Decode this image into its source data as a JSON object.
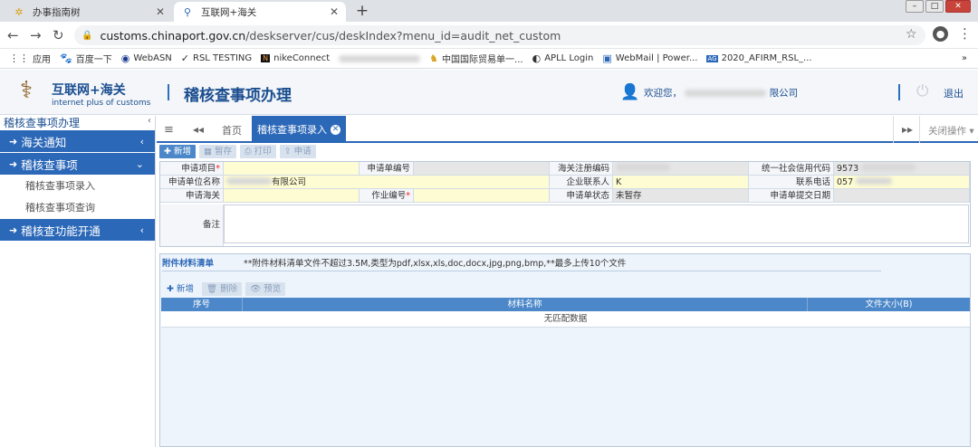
{
  "browser": {
    "tabs": [
      {
        "label": "办事指南树",
        "icon": "gear-icon"
      },
      {
        "label": "互联网+海关",
        "icon": "customs-icon"
      }
    ],
    "url_domain": "customs.chinaport.gov.cn",
    "url_path": "/deskserver/cus/deskIndex?menu_id=audit_net_custom",
    "bookmarks": [
      "应用",
      "百度一下",
      "WebASN",
      "RSL TESTING",
      "nikeConnect",
      "中国国际贸易单一...",
      "APLL Login",
      "WebMail | Power...",
      "2020_AFIRM_RSL_..."
    ]
  },
  "header": {
    "logo_cn": "互联网+海关",
    "logo_en": "internet plus of customs",
    "title": "稽核查事项办理",
    "welcome_prefix": "欢迎您，",
    "welcome_suffix": "限公司",
    "logout": "退出"
  },
  "sidebar": {
    "title": "稽核查事项办理",
    "items": [
      {
        "label": "海关通知",
        "arrow": "‹"
      },
      {
        "label": "稽核查事项",
        "arrow": "⌄"
      },
      {
        "label": "稽核查功能开通",
        "arrow": "‹"
      }
    ],
    "subitems": [
      "稽核查事项录入",
      "稽核查事项查询"
    ]
  },
  "tabbar": {
    "home": "首页",
    "active": "稽核查事项录入",
    "close_ops": "关闭操作"
  },
  "toolbar": {
    "add": "新增",
    "save": "暂存",
    "print": "打印",
    "apply": "申请"
  },
  "form": {
    "row1": {
      "l1": "申请项目",
      "l2": "申请单编号",
      "l3": "海关注册编码",
      "l4": "统一社会信用代码",
      "v4": "9573"
    },
    "row2": {
      "l1": "申请单位名称",
      "v1": "有限公司",
      "l3": "企业联系人",
      "v3": "K",
      "l4": "联系电话",
      "v4": "057"
    },
    "row3": {
      "l1": "申请海关",
      "l2": "作业编号",
      "l3": "申请单状态",
      "v3": "未暂存",
      "l4": "申请单提交日期"
    },
    "memo_label": "备注"
  },
  "attachments": {
    "title": "附件材料清单",
    "note": "**附件材料清单文件不超过3.5M,类型为pdf,xlsx,xls,doc,docx,jpg,png,bmp,**最多上传10个文件",
    "add": "新增",
    "delete": "删除",
    "preview": "预览",
    "columns": [
      "序号",
      "材料名称",
      "文件大小(B)"
    ],
    "empty": "无匹配数据"
  }
}
